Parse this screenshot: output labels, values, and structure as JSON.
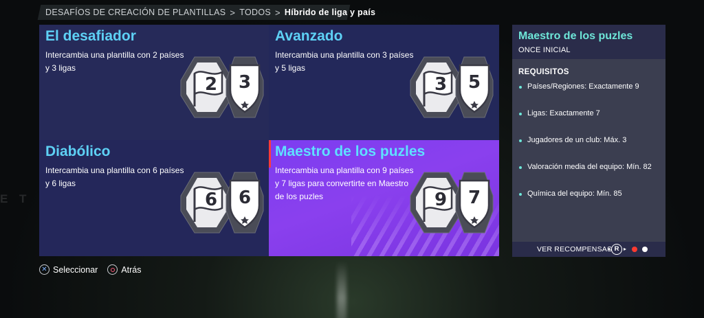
{
  "breadcrumb": {
    "items": [
      "DESAFÍOS DE CREACIÓN DE PLANTILLAS",
      "TODOS",
      "Híbrido de liga y país"
    ],
    "separator": ">"
  },
  "challenges": [
    {
      "title": "El desafiador",
      "description": "Intercambia una plantilla con 2 países y 3 ligas",
      "countries": "2",
      "leagues": "3",
      "selected": false
    },
    {
      "title": "Avanzado",
      "description": "Intercambia una plantilla con 3 países y 5 ligas",
      "countries": "3",
      "leagues": "5",
      "selected": false
    },
    {
      "title": "Diabólico",
      "description": "Intercambia una plantilla con 6 países y 6 ligas",
      "countries": "6",
      "leagues": "6",
      "selected": false
    },
    {
      "title": "Maestro de los puzles",
      "description": "Intercambia una plantilla con 9 países y 7 ligas para convertirte en Maestro de los puzles",
      "countries": "9",
      "leagues": "7",
      "selected": true
    }
  ],
  "detail_panel": {
    "title": "Maestro de los puzles",
    "subtitle": "ONCE INICIAL",
    "requirements_heading": "REQUISITOS",
    "requirements": [
      "Países/Regiones: Exactamente 9",
      "Ligas: Exactamente 7",
      "Jugadores de un club: Máx. 3",
      "Valoración media del equipo: Mín. 82",
      "Química del equipo: Mín. 85"
    ],
    "rewards_label": "VER RECOMPENSAS",
    "rewards_button": "R",
    "page_count": 2,
    "current_page": 1
  },
  "hints": {
    "select_label": "Seleccionar",
    "back_label": "Atrás"
  },
  "colors": {
    "title_accent": "#5ed1f5",
    "panel_title": "#6ee6d8",
    "selected_tile": "#8a40ee",
    "tile_bg": "#24275a",
    "active_dot": "#ff3b30"
  },
  "icons": [
    "flag-icon",
    "shield-icon",
    "cross-button-icon",
    "circle-button-icon",
    "r-stick-icon"
  ]
}
